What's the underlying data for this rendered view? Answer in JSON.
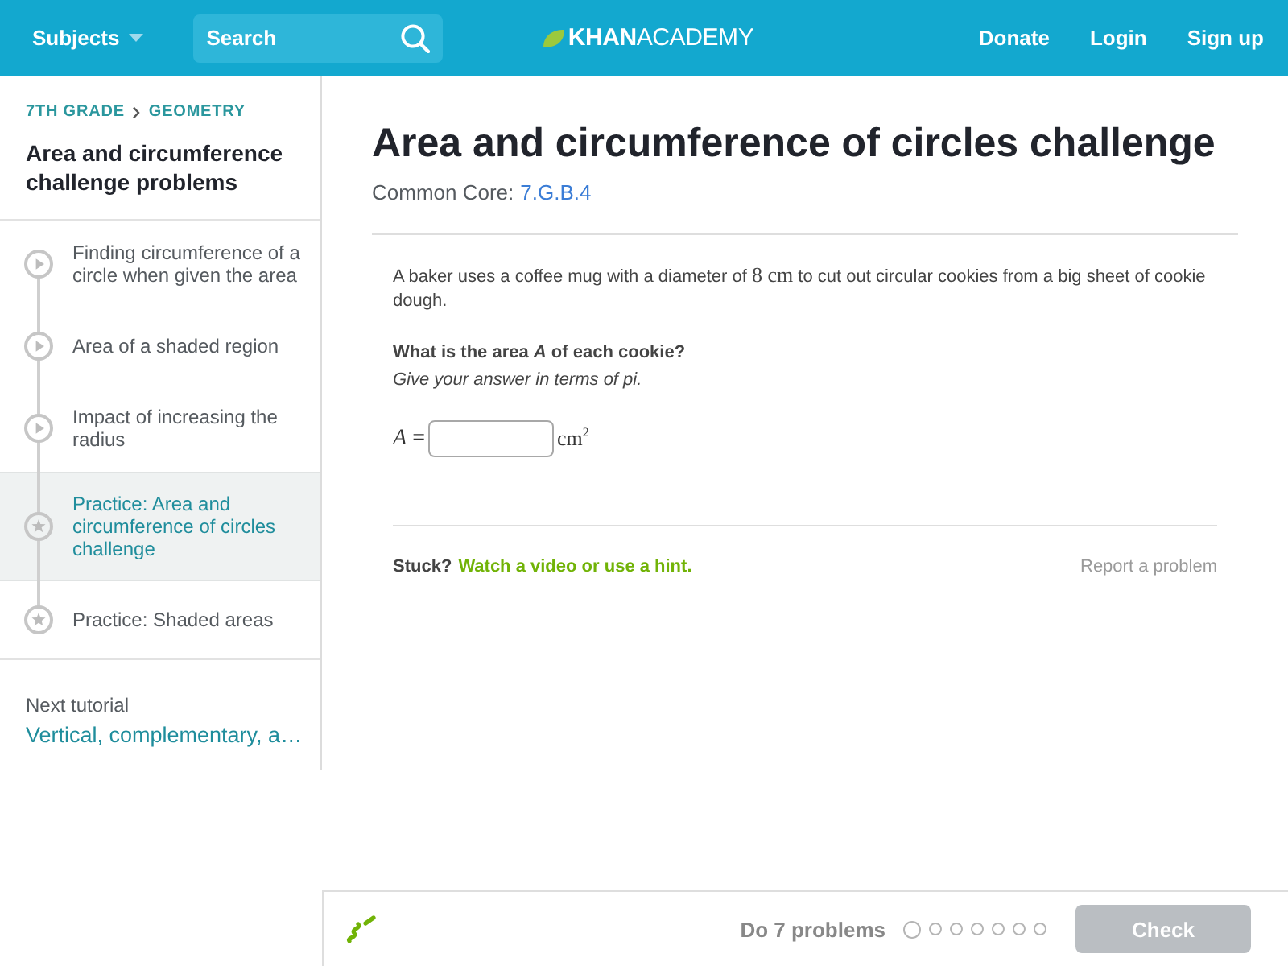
{
  "header": {
    "subjects": "Subjects",
    "search": {
      "placeholder": "Search"
    },
    "logo": "**KHAN**ACADEMY",
    "links": [
      "Donate",
      "Login",
      "Sign up"
    ]
  },
  "sidebar": {
    "breadcrumb": [
      "7TH GRADE",
      "GEOMETRY"
    ],
    "title": "Area and circumference challenge problems",
    "items": [
      {
        "kind": "video",
        "label": "Finding circumference of a circle when given the area",
        "selected": false
      },
      {
        "kind": "video",
        "label": "Area of a shaded region",
        "selected": false
      },
      {
        "kind": "video",
        "label": "Impact of increasing the radius",
        "selected": false
      },
      {
        "kind": "practice",
        "label": "Practice: Area and circumference of circles challenge",
        "selected": true
      },
      {
        "kind": "practice",
        "label": "Practice: Shaded areas",
        "selected": false
      }
    ],
    "next_tutorial": {
      "label": "Next tutorial",
      "link": "Vertical, complementary, a…"
    }
  },
  "exercise": {
    "title": "Area and circumference of circles challenge",
    "standard": {
      "label": "Common Core:",
      "code": "7.G.B.4"
    },
    "problem": [
      {
        "kind": "text",
        "text": "A baker uses a coffee mug with a diameter of "
      },
      {
        "kind": "math",
        "text": "8 cm"
      },
      {
        "kind": "text",
        "text": " to cut out circular cookies from a big sheet of cookie dough."
      }
    ],
    "question": "What is the area *A* of each cookie?",
    "hint": "Give your answer in terms of pi.",
    "answer": {
      "lhs": "*A* =",
      "unit": "cm$^{2}$"
    },
    "help": {
      "label": "Stuck?",
      "link": "Watch a video or use a hint."
    },
    "report": "Report a problem"
  },
  "footer": {
    "task": "Do 7 problems",
    "progress": [
      {
        "current": true
      },
      {
        "current": false
      },
      {
        "current": false
      },
      {
        "current": false
      },
      {
        "current": false
      },
      {
        "current": false
      },
      {
        "current": false
      }
    ],
    "check": {
      "label": "Check",
      "disabled": true
    }
  }
}
